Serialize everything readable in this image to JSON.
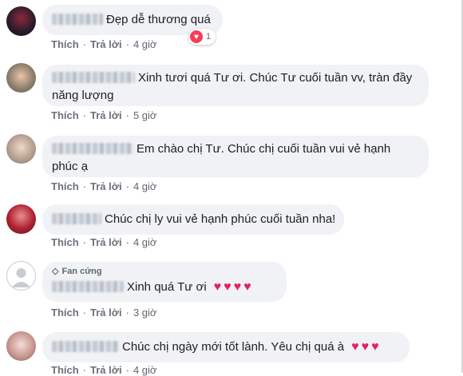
{
  "comments": [
    {
      "text": "Đẹp dễ thương quá",
      "time": "4 giờ",
      "reaction_count": "1"
    },
    {
      "text1": "Xinh tươi quá Tư ơi. Chúc Tư cuối tuần vv, tràn đầy",
      "text2": "năng lượng",
      "time": "5 giờ"
    },
    {
      "text1": "Em chào chị Tư. Chúc chị cuối tuần vui vẻ hạnh",
      "text2": "phúc ạ",
      "time": "4 giờ"
    },
    {
      "text": "Chúc chị ly vui vẻ hạnh phúc cuối tuần nha!",
      "time": "4 giờ"
    },
    {
      "badge": "Fan cứng",
      "text": "Xinh quá Tư ơi",
      "time": "3 giờ"
    },
    {
      "text": "Chúc chị ngày mới tốt lành. Yêu chị quá à",
      "time": "4 giờ"
    }
  ],
  "actions": {
    "like": "Thích",
    "reply": "Trả lời",
    "dot": "·"
  },
  "colors": {
    "bubble": "#f0f2f5",
    "heart": "#f33e58",
    "meta": "#606770"
  },
  "icons": {
    "badge": "diamond-icon",
    "reaction": "heart-icon",
    "emoji": "heart-emoji-icon"
  }
}
